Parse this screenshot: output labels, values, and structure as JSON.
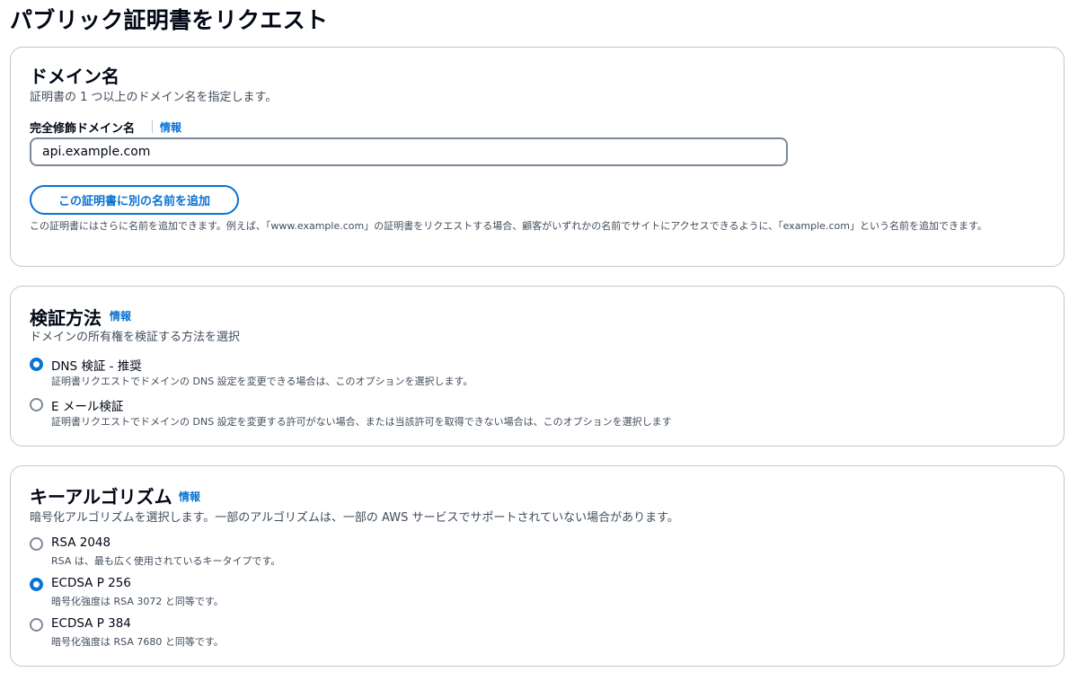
{
  "page": {
    "title": "パブリック証明書をリクエスト"
  },
  "domain_section": {
    "heading": "ドメイン名",
    "description": "証明書の 1 つ以上のドメイン名を指定します。",
    "field_label": "完全修飾ドメイン名",
    "info_link": "情報",
    "input_value": "api.example.com",
    "add_button": "この証明書に別の名前を追加",
    "hint": "この証明書にはさらに名前を追加できます。例えば、「www.example.com」の証明書をリクエストする場合、顧客がいずれかの名前でサイトにアクセスできるように、「example.com」という名前を追加できます。"
  },
  "validation_section": {
    "heading": "検証方法",
    "info_link": "情報",
    "description": "ドメインの所有権を検証する方法を選択",
    "options": [
      {
        "label": "DNS 検証 - 推奨",
        "description": "証明書リクエストでドメインの DNS 設定を変更できる場合は、このオプションを選択します。",
        "selected": true
      },
      {
        "label": "E メール検証",
        "description": "証明書リクエストでドメインの DNS 設定を変更する許可がない場合、または当該許可を取得できない場合は、このオプションを選択します",
        "selected": false
      }
    ]
  },
  "algorithm_section": {
    "heading": "キーアルゴリズム",
    "info_link": "情報",
    "description": "暗号化アルゴリズムを選択します。一部のアルゴリズムは、一部の AWS サービスでサポートされていない場合があります。",
    "options": [
      {
        "label": "RSA 2048",
        "description": "RSA は、最も広く使用されているキータイプです。",
        "selected": false
      },
      {
        "label": "ECDSA P 256",
        "description": "暗号化強度は RSA 3072 と同等です。",
        "selected": true
      },
      {
        "label": "ECDSA P 384",
        "description": "暗号化強度は RSA 7680 と同等です。",
        "selected": false
      }
    ]
  },
  "colors": {
    "accent": "#0972d3",
    "border": "#c6c6cd",
    "text": "#000716",
    "muted": "#414d5c"
  }
}
